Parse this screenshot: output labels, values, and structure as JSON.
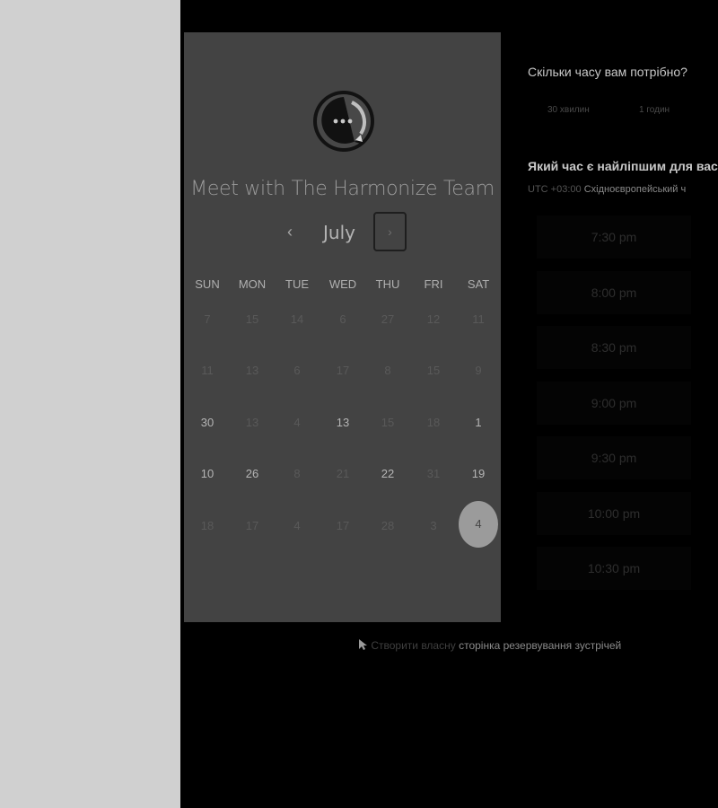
{
  "booking_panel": {
    "title": "Meet with The Harmonize Team",
    "month": "July",
    "prev_icon": "‹",
    "next_icon": "›",
    "weekdays": [
      "SUN",
      "MON",
      "TUE",
      "WED",
      "THU",
      "FRI",
      "SAT"
    ],
    "weeks": [
      [
        "7",
        "15",
        "14",
        "6",
        "27",
        "12",
        "11"
      ],
      [
        "11",
        "13",
        "6",
        "17",
        "8",
        "15",
        "9"
      ],
      [
        "30",
        "13",
        "4",
        "13",
        "15",
        "18",
        "1"
      ],
      [
        "10",
        "26",
        "8",
        "21",
        "22",
        "31",
        "19"
      ],
      [
        "18",
        "17",
        "4",
        "17",
        "28",
        "3",
        "4"
      ]
    ],
    "selected_day": "4"
  },
  "duration": {
    "question": "Скільки часу вам потрібно?",
    "options": [
      "30 хвилин",
      "1 годин"
    ]
  },
  "time_selection": {
    "question": "Який час є найліпшим для вас",
    "utc_offset": "UTC +03:00",
    "timezone_name": "Східноєвропейський ч",
    "slots": [
      "7:30 pm",
      "8:00 pm",
      "8:30 pm",
      "9:00 pm",
      "9:30 pm",
      "10:00 pm",
      "10:30 pm"
    ]
  },
  "footer": {
    "icon": "pointer-icon",
    "link_dim": "Створити власну",
    "link_text": "сторінка резервування зустрічей"
  },
  "colors": {
    "panel_bg": "#434343",
    "page_bg": "#000000",
    "sidebar_bg": "#d0d0d0",
    "selected_day_bg": "#9b9b9b"
  }
}
